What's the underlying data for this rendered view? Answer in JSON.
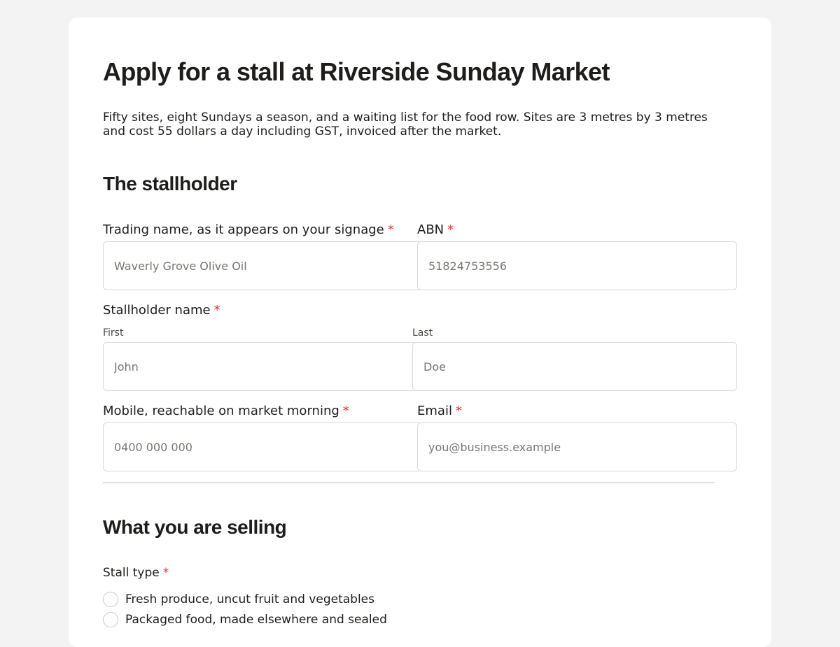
{
  "page": {
    "title": "Apply for a stall at Riverside Sunday Market",
    "intro": "Fifty sites, eight Sundays a season, and a waiting list for the food row. Sites are 3 metres by 3 metres and cost 55 dollars a day including GST, invoiced after the market."
  },
  "stallholder": {
    "heading": "The stallholder",
    "required_mark": "*",
    "trading_name": {
      "label": "Trading name, as it appears on your signage",
      "placeholder": "Waverly Grove Olive Oil"
    },
    "abn": {
      "label": "ABN",
      "placeholder": "51824753556"
    },
    "name": {
      "label": "Stallholder name",
      "first": {
        "sublabel": "First",
        "placeholder": "John"
      },
      "last": {
        "sublabel": "Last",
        "placeholder": "Doe"
      }
    },
    "mobile": {
      "label": "Mobile, reachable on market morning",
      "placeholder": "0400 000 000"
    },
    "email": {
      "label": "Email",
      "placeholder": "you@business.example"
    }
  },
  "selling": {
    "heading": "What you are selling",
    "stall_type": {
      "label": "Stall type",
      "options": [
        "Fresh produce, uncut fruit and vegetables",
        "Packaged food, made elsewhere and sealed"
      ]
    }
  },
  "colors": {
    "required": "#d43a2f",
    "card": "#ffffff",
    "background": "#f3f3f3"
  }
}
